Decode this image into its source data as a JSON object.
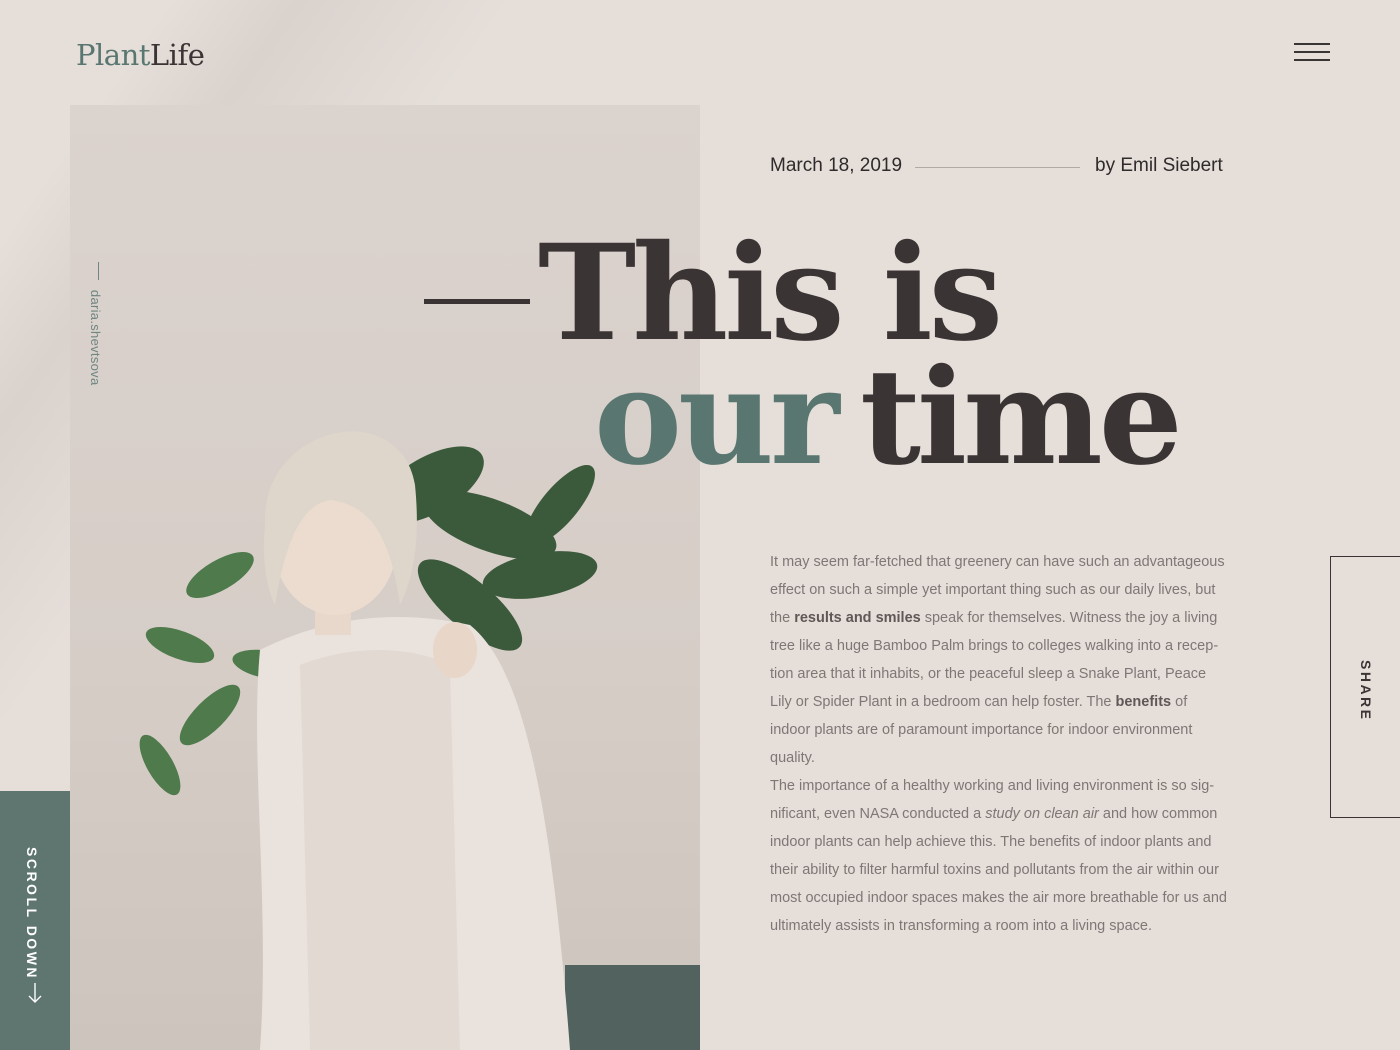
{
  "brand": {
    "logo_part1": "Plant",
    "logo_part2": "Life"
  },
  "header": {
    "menu_icon": "hamburger-menu-icon"
  },
  "hero_image": {
    "credit": "daria.shevtsova"
  },
  "scroll_cta": {
    "label": "SCROLL DOWN",
    "icon": "arrow-down-icon"
  },
  "article": {
    "date": "March 18, 2019",
    "author": "by Emil Siebert",
    "headline": {
      "line1": "This is",
      "line2_accent": "our",
      "line2_rest": "time"
    },
    "paragraph1": {
      "text_1": "It may seem far-fetched that greenery can have such an advantageous effect on such a simple yet important thing such as our daily lives, but the ",
      "bold_1": "results and smiles",
      "text_2": " speak for themselves. Witness the joy a living tree like a huge Bamboo Palm brings to colleges walking into a recep­tion area that it inhabits, or the peaceful sleep a Snake Plant, Peace Lily or Spider Plant in a bedroom can help foster. The ",
      "bold_2": "benefits",
      "text_3": " of indoor plants are of paramount importance for indoor environment quality."
    },
    "paragraph2": {
      "text_1": "The importance of a healthy working and living environment is so sig­nificant, even NASA conducted a ",
      "italic_1": "study on clean air",
      "text_2": " and how common indoor plants can help achieve this. The benefits of indoor plants and their ability to filter harmful toxins and pollutants from the air within our most occupied indoor spaces makes the air more breathable for us and ultimately assists in transforming a room into a living space."
    }
  },
  "share": {
    "label": "SHARE"
  },
  "colors": {
    "accent": "#5a7670",
    "text_dark": "#3a3435",
    "background": "#e5ded9"
  }
}
